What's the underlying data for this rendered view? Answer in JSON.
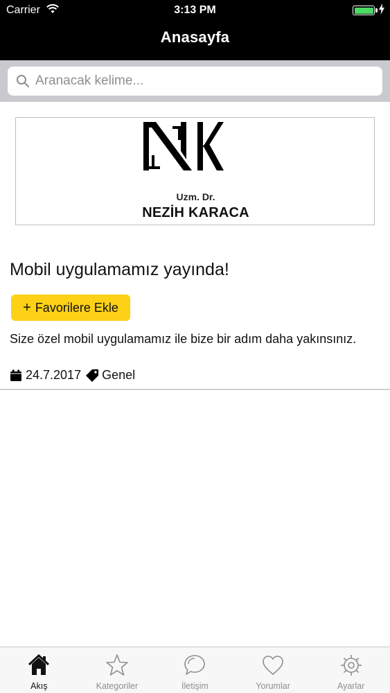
{
  "status_bar": {
    "carrier": "Carrier",
    "time": "3:13 PM",
    "battery_color": "#4cd964"
  },
  "nav": {
    "title": "Anasayfa"
  },
  "search": {
    "placeholder": "Aranacak kelime...",
    "value": "",
    "icon": "search-icon"
  },
  "feed": {
    "post": {
      "logo_subtitle": "Uzm. Dr.",
      "logo_name": "NEZİH KARACA",
      "title": "Mobil uygulamamız yayında!",
      "favorite_button": {
        "icon": "plus-icon",
        "label": "Favorilere Ekle",
        "color": "#fcd116"
      },
      "body": "Size özel mobil uygulamamız ile bize bir adım daha yakınsınız.",
      "date_icon": "calendar-icon",
      "date": "24.7.2017",
      "category_icon": "tag-icon",
      "category": "Genel"
    }
  },
  "tabbar": {
    "active_color": "#111111",
    "inactive_color": "#8e8e93",
    "items": [
      {
        "label": "Akış",
        "icon": "home-icon",
        "active": true
      },
      {
        "label": "Kategoriler",
        "icon": "star-icon",
        "active": false
      },
      {
        "label": "İletişim",
        "icon": "chat-bubble-icon",
        "active": false
      },
      {
        "label": "Yorumlar",
        "icon": "heart-icon",
        "active": false
      },
      {
        "label": "Ayarlar",
        "icon": "gear-icon",
        "active": false
      }
    ]
  }
}
